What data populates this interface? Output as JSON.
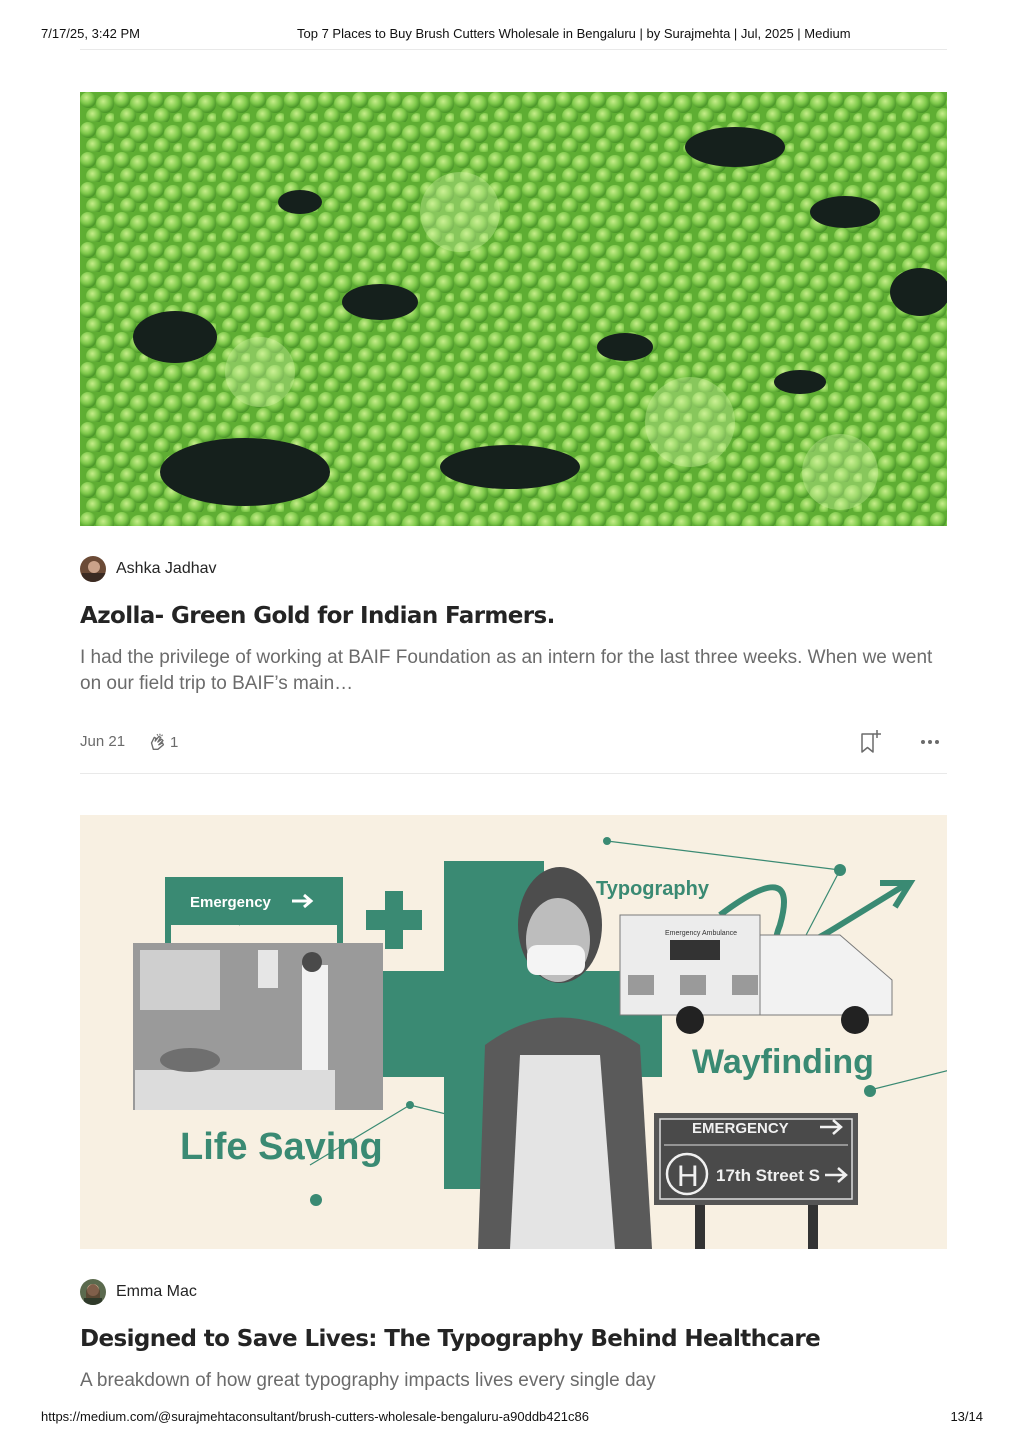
{
  "print_header": {
    "datetime": "7/17/25, 3:42 PM",
    "title": "Top 7 Places to Buy Brush Cutters Wholesale in Bengaluru | by Surajmehta | Jul, 2025 | Medium"
  },
  "posts": [
    {
      "image_icon": "azolla-photo",
      "author": "Ashka Jadhav",
      "title": "Azolla- Green Gold for Indian Farmers.",
      "subtitle": "I had the privilege of working at BAIF Foundation as an intern for the last three weeks. When we went on our field trip to BAIF’s main…",
      "date": "Jun 21",
      "claps": "1"
    },
    {
      "image_icon": "healthcare-typography-collage",
      "image_text": {
        "emergency_sign": "Emergency",
        "typography": "Typography",
        "ambulance": "Emergency Ambulance",
        "wayfinding": "Wayfinding",
        "life_saving": "Life Saving",
        "road_sign_top": "EMERGENCY",
        "road_sign_h": "H",
        "road_sign_street": "17th Street S"
      },
      "author": "Emma Mac",
      "title": "Designed to Save Lives: The Typography Behind Healthcare",
      "subtitle": "A breakdown of how great typography impacts lives every single day"
    }
  ],
  "print_footer": {
    "url": "https://medium.com/@surajmehtaconsultant/brush-cutters-wholesale-bengaluru-a90ddb421c86",
    "page": "13/14"
  },
  "colors": {
    "text": "#242424",
    "muted": "#6b6b6b",
    "rule": "#e9e9e9",
    "teal": "#3a8a73",
    "cream": "#f8f0e2",
    "azolla_green": "#7ec94a"
  }
}
